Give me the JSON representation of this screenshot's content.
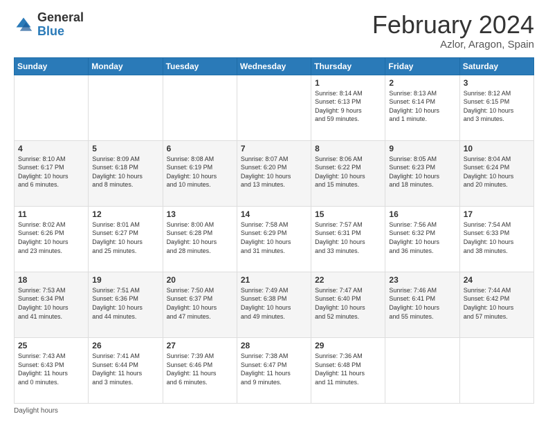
{
  "logo": {
    "general": "General",
    "blue": "Blue"
  },
  "header": {
    "month_year": "February 2024",
    "location": "Azlor, Aragon, Spain"
  },
  "days_of_week": [
    "Sunday",
    "Monday",
    "Tuesday",
    "Wednesday",
    "Thursday",
    "Friday",
    "Saturday"
  ],
  "footer": {
    "daylight_label": "Daylight hours"
  },
  "weeks": [
    [
      {
        "day": "",
        "info": ""
      },
      {
        "day": "",
        "info": ""
      },
      {
        "day": "",
        "info": ""
      },
      {
        "day": "",
        "info": ""
      },
      {
        "day": "1",
        "info": "Sunrise: 8:14 AM\nSunset: 6:13 PM\nDaylight: 9 hours\nand 59 minutes."
      },
      {
        "day": "2",
        "info": "Sunrise: 8:13 AM\nSunset: 6:14 PM\nDaylight: 10 hours\nand 1 minute."
      },
      {
        "day": "3",
        "info": "Sunrise: 8:12 AM\nSunset: 6:15 PM\nDaylight: 10 hours\nand 3 minutes."
      }
    ],
    [
      {
        "day": "4",
        "info": "Sunrise: 8:10 AM\nSunset: 6:17 PM\nDaylight: 10 hours\nand 6 minutes."
      },
      {
        "day": "5",
        "info": "Sunrise: 8:09 AM\nSunset: 6:18 PM\nDaylight: 10 hours\nand 8 minutes."
      },
      {
        "day": "6",
        "info": "Sunrise: 8:08 AM\nSunset: 6:19 PM\nDaylight: 10 hours\nand 10 minutes."
      },
      {
        "day": "7",
        "info": "Sunrise: 8:07 AM\nSunset: 6:20 PM\nDaylight: 10 hours\nand 13 minutes."
      },
      {
        "day": "8",
        "info": "Sunrise: 8:06 AM\nSunset: 6:22 PM\nDaylight: 10 hours\nand 15 minutes."
      },
      {
        "day": "9",
        "info": "Sunrise: 8:05 AM\nSunset: 6:23 PM\nDaylight: 10 hours\nand 18 minutes."
      },
      {
        "day": "10",
        "info": "Sunrise: 8:04 AM\nSunset: 6:24 PM\nDaylight: 10 hours\nand 20 minutes."
      }
    ],
    [
      {
        "day": "11",
        "info": "Sunrise: 8:02 AM\nSunset: 6:26 PM\nDaylight: 10 hours\nand 23 minutes."
      },
      {
        "day": "12",
        "info": "Sunrise: 8:01 AM\nSunset: 6:27 PM\nDaylight: 10 hours\nand 25 minutes."
      },
      {
        "day": "13",
        "info": "Sunrise: 8:00 AM\nSunset: 6:28 PM\nDaylight: 10 hours\nand 28 minutes."
      },
      {
        "day": "14",
        "info": "Sunrise: 7:58 AM\nSunset: 6:29 PM\nDaylight: 10 hours\nand 31 minutes."
      },
      {
        "day": "15",
        "info": "Sunrise: 7:57 AM\nSunset: 6:31 PM\nDaylight: 10 hours\nand 33 minutes."
      },
      {
        "day": "16",
        "info": "Sunrise: 7:56 AM\nSunset: 6:32 PM\nDaylight: 10 hours\nand 36 minutes."
      },
      {
        "day": "17",
        "info": "Sunrise: 7:54 AM\nSunset: 6:33 PM\nDaylight: 10 hours\nand 38 minutes."
      }
    ],
    [
      {
        "day": "18",
        "info": "Sunrise: 7:53 AM\nSunset: 6:34 PM\nDaylight: 10 hours\nand 41 minutes."
      },
      {
        "day": "19",
        "info": "Sunrise: 7:51 AM\nSunset: 6:36 PM\nDaylight: 10 hours\nand 44 minutes."
      },
      {
        "day": "20",
        "info": "Sunrise: 7:50 AM\nSunset: 6:37 PM\nDaylight: 10 hours\nand 47 minutes."
      },
      {
        "day": "21",
        "info": "Sunrise: 7:49 AM\nSunset: 6:38 PM\nDaylight: 10 hours\nand 49 minutes."
      },
      {
        "day": "22",
        "info": "Sunrise: 7:47 AM\nSunset: 6:40 PM\nDaylight: 10 hours\nand 52 minutes."
      },
      {
        "day": "23",
        "info": "Sunrise: 7:46 AM\nSunset: 6:41 PM\nDaylight: 10 hours\nand 55 minutes."
      },
      {
        "day": "24",
        "info": "Sunrise: 7:44 AM\nSunset: 6:42 PM\nDaylight: 10 hours\nand 57 minutes."
      }
    ],
    [
      {
        "day": "25",
        "info": "Sunrise: 7:43 AM\nSunset: 6:43 PM\nDaylight: 11 hours\nand 0 minutes."
      },
      {
        "day": "26",
        "info": "Sunrise: 7:41 AM\nSunset: 6:44 PM\nDaylight: 11 hours\nand 3 minutes."
      },
      {
        "day": "27",
        "info": "Sunrise: 7:39 AM\nSunset: 6:46 PM\nDaylight: 11 hours\nand 6 minutes."
      },
      {
        "day": "28",
        "info": "Sunrise: 7:38 AM\nSunset: 6:47 PM\nDaylight: 11 hours\nand 9 minutes."
      },
      {
        "day": "29",
        "info": "Sunrise: 7:36 AM\nSunset: 6:48 PM\nDaylight: 11 hours\nand 11 minutes."
      },
      {
        "day": "",
        "info": ""
      },
      {
        "day": "",
        "info": ""
      }
    ]
  ]
}
